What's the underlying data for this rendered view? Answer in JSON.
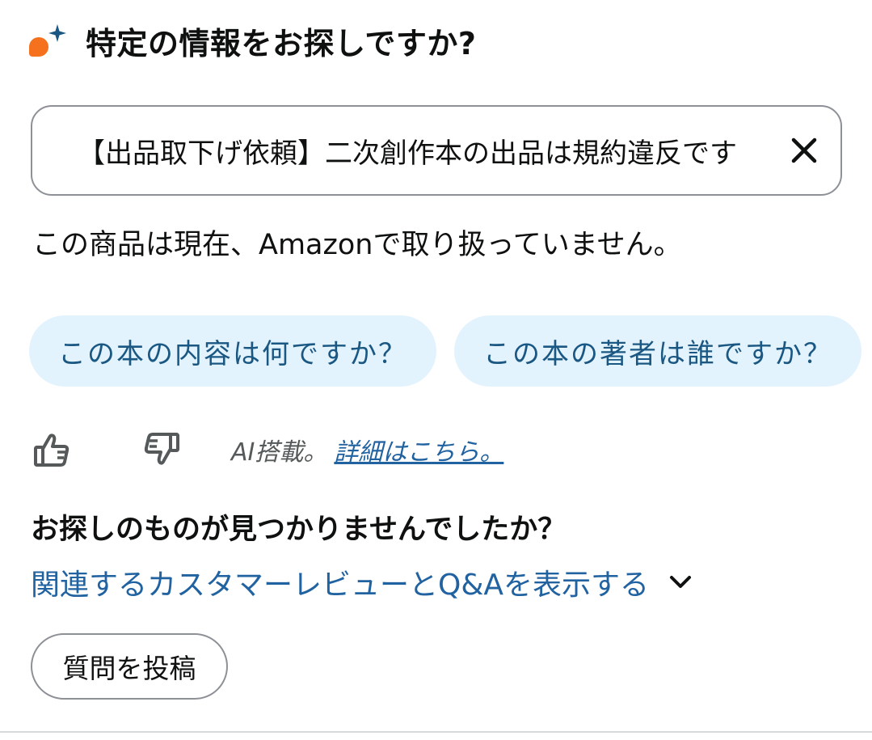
{
  "header": {
    "title": "特定の情報をお探しですか?",
    "icon": "rufus-spark-icon"
  },
  "search": {
    "value": "【出品取下げ依頼】二次創作本の出品は規約違反です",
    "clear_icon": "close-icon"
  },
  "answer": "この商品は現在、Amazonで取り扱っていません。",
  "suggestions": [
    "この本の内容は何ですか？",
    "この本の著者は誰ですか？"
  ],
  "feedback": {
    "thumbs_up_icon": "thumbs-up-icon",
    "thumbs_down_icon": "thumbs-down-icon",
    "ai_note": "AI搭載。",
    "details_link": "詳細はこちら。"
  },
  "not_found": "お探しのものが見つかりませんでしたか？",
  "related_link": "関連するカスタマーレビューとQ&Aを表示する",
  "post_button": "質問を投稿",
  "colors": {
    "accent_orange": "#f5711d",
    "spark_blue": "#1a5782",
    "link_blue": "#2162a1",
    "chip_bg": "#e3f3fd"
  }
}
